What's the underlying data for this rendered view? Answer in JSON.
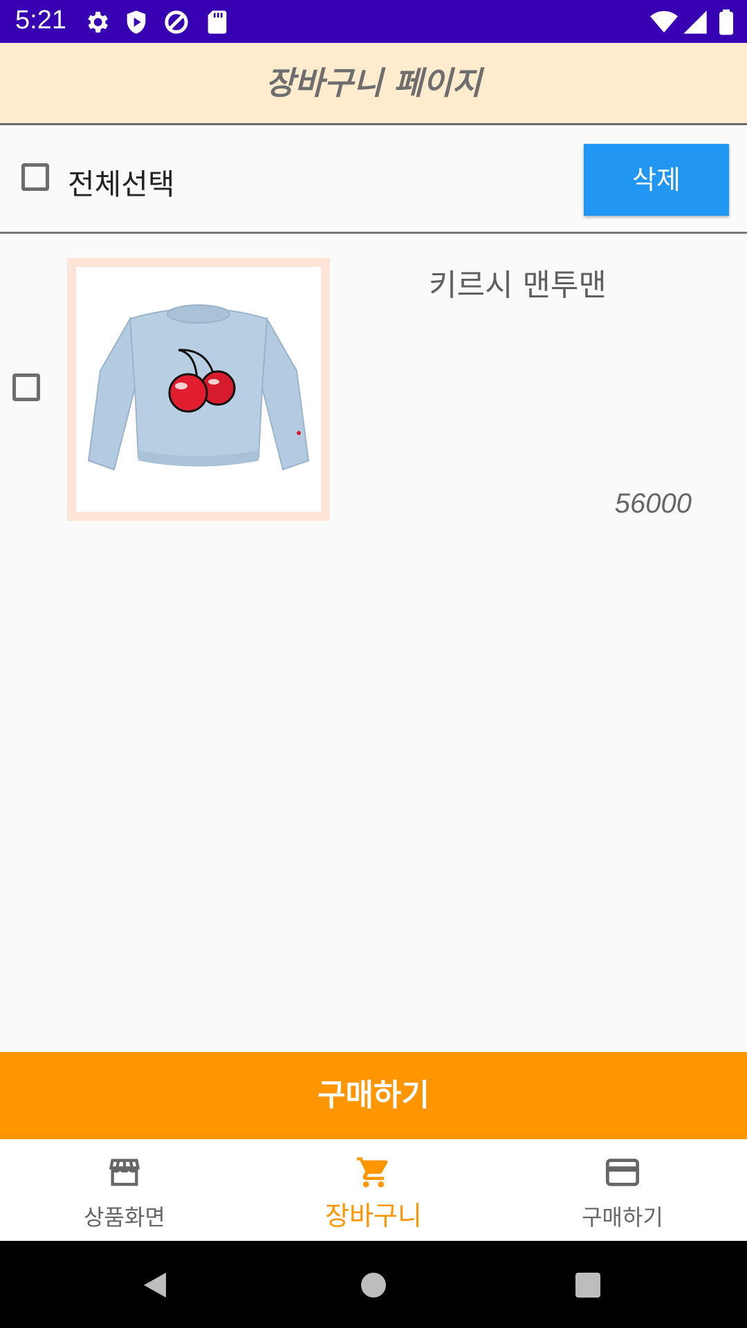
{
  "status_bar": {
    "time": "5:21"
  },
  "header": {
    "title": "장바구니 페이지"
  },
  "toolbar": {
    "select_all_label": "전체선택",
    "delete_label": "삭제"
  },
  "cart_items": [
    {
      "name": "키르시 맨투맨",
      "price": "56000"
    }
  ],
  "buy_button_label": "구매하기",
  "bottom_nav": {
    "items": [
      {
        "label": "상품화면",
        "icon": "store-icon"
      },
      {
        "label": "장바구니",
        "icon": "cart-icon"
      },
      {
        "label": "구매하기",
        "icon": "credit-card-icon"
      }
    ],
    "active_index": 1
  },
  "colors": {
    "status_bar": "#3700b3",
    "header_bg": "#ffebcd",
    "delete_button": "#2196f3",
    "buy_button": "#ff9500",
    "active_nav": "#ff9500"
  }
}
